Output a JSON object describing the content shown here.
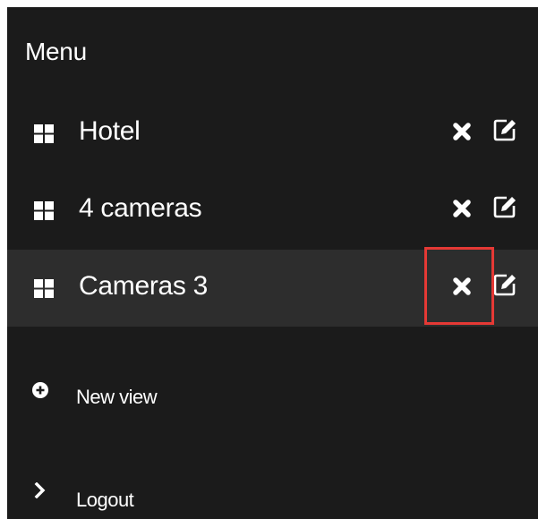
{
  "menu": {
    "title": "Menu"
  },
  "views": [
    {
      "label": "Hotel",
      "active": false
    },
    {
      "label": "4 cameras",
      "active": false
    },
    {
      "label": "Cameras 3",
      "active": true
    }
  ],
  "actions": {
    "new_view_label": "New view",
    "logout_label": "Logout"
  },
  "icons": {
    "view": "grid-icon",
    "delete": "close-icon",
    "edit": "edit-icon",
    "new_view": "plus-circle-icon",
    "logout": "chevron-right-icon"
  },
  "colors": {
    "panel_background": "#1b1b1b",
    "active_row_background": "#2d2d2d",
    "text": "#ffffff",
    "highlight": "#e53935"
  }
}
